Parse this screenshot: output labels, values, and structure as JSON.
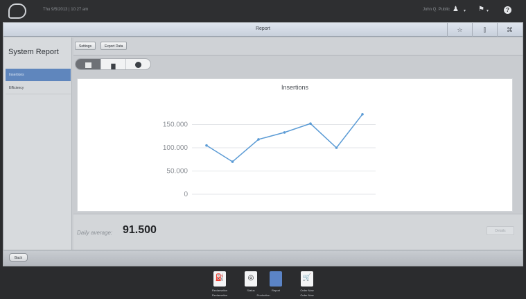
{
  "header": {
    "datetime": "Thu 9/5/2013 | 10:27 am",
    "user_name": "John Q. Public",
    "user_icon": "user-icon",
    "flag_icon": "flag-icon",
    "help_icon": "help-icon"
  },
  "window": {
    "title": "Report",
    "buttons": [
      "star-icon",
      "collapse-icon",
      "fullscreen-icon"
    ]
  },
  "sidebar": {
    "title": "System Report",
    "items": [
      {
        "label": "Insertions",
        "active": true
      },
      {
        "label": "Efficiency",
        "active": false
      }
    ]
  },
  "toolbar": {
    "settings_label": "Settings",
    "export_label": "Export Data"
  },
  "view_toggle": {
    "options": [
      "table-view-icon",
      "bar-chart-icon",
      "pie-chart-icon"
    ],
    "selected_index": 0
  },
  "chart_data": {
    "type": "line",
    "title": "Insertions",
    "xlabel": "",
    "ylabel": "",
    "x": [
      1,
      2,
      3,
      4,
      5,
      6,
      7
    ],
    "series": [
      {
        "values": [
          105000,
          70000,
          118000,
          133000,
          152000,
          100000,
          172000
        ]
      }
    ],
    "y_ticks": [
      "0",
      "50.000",
      "100.000",
      "150.000"
    ],
    "ylim": [
      0,
      200000
    ],
    "grid": true,
    "line_color": "#5b9bd5"
  },
  "summary": {
    "label": "Daily average:",
    "value": "91.500",
    "details_label": "Details"
  },
  "footer": {
    "back_label": "Back"
  },
  "dock": {
    "items": [
      {
        "label": "Reclamation",
        "icon": "fuel-pump-icon",
        "active": false
      },
      {
        "label": "Status",
        "icon": "gauge-icon",
        "active": false
      },
      {
        "label": "Report",
        "icon": "folder-icon",
        "active": true
      },
      {
        "label": "Order Now",
        "icon": "cart-icon",
        "active": false
      }
    ],
    "groups": [
      "Reclamation",
      "Production",
      "Order Now"
    ]
  },
  "colors": {
    "accent": "#5f86bd",
    "chart_line": "#5b9bd5"
  }
}
